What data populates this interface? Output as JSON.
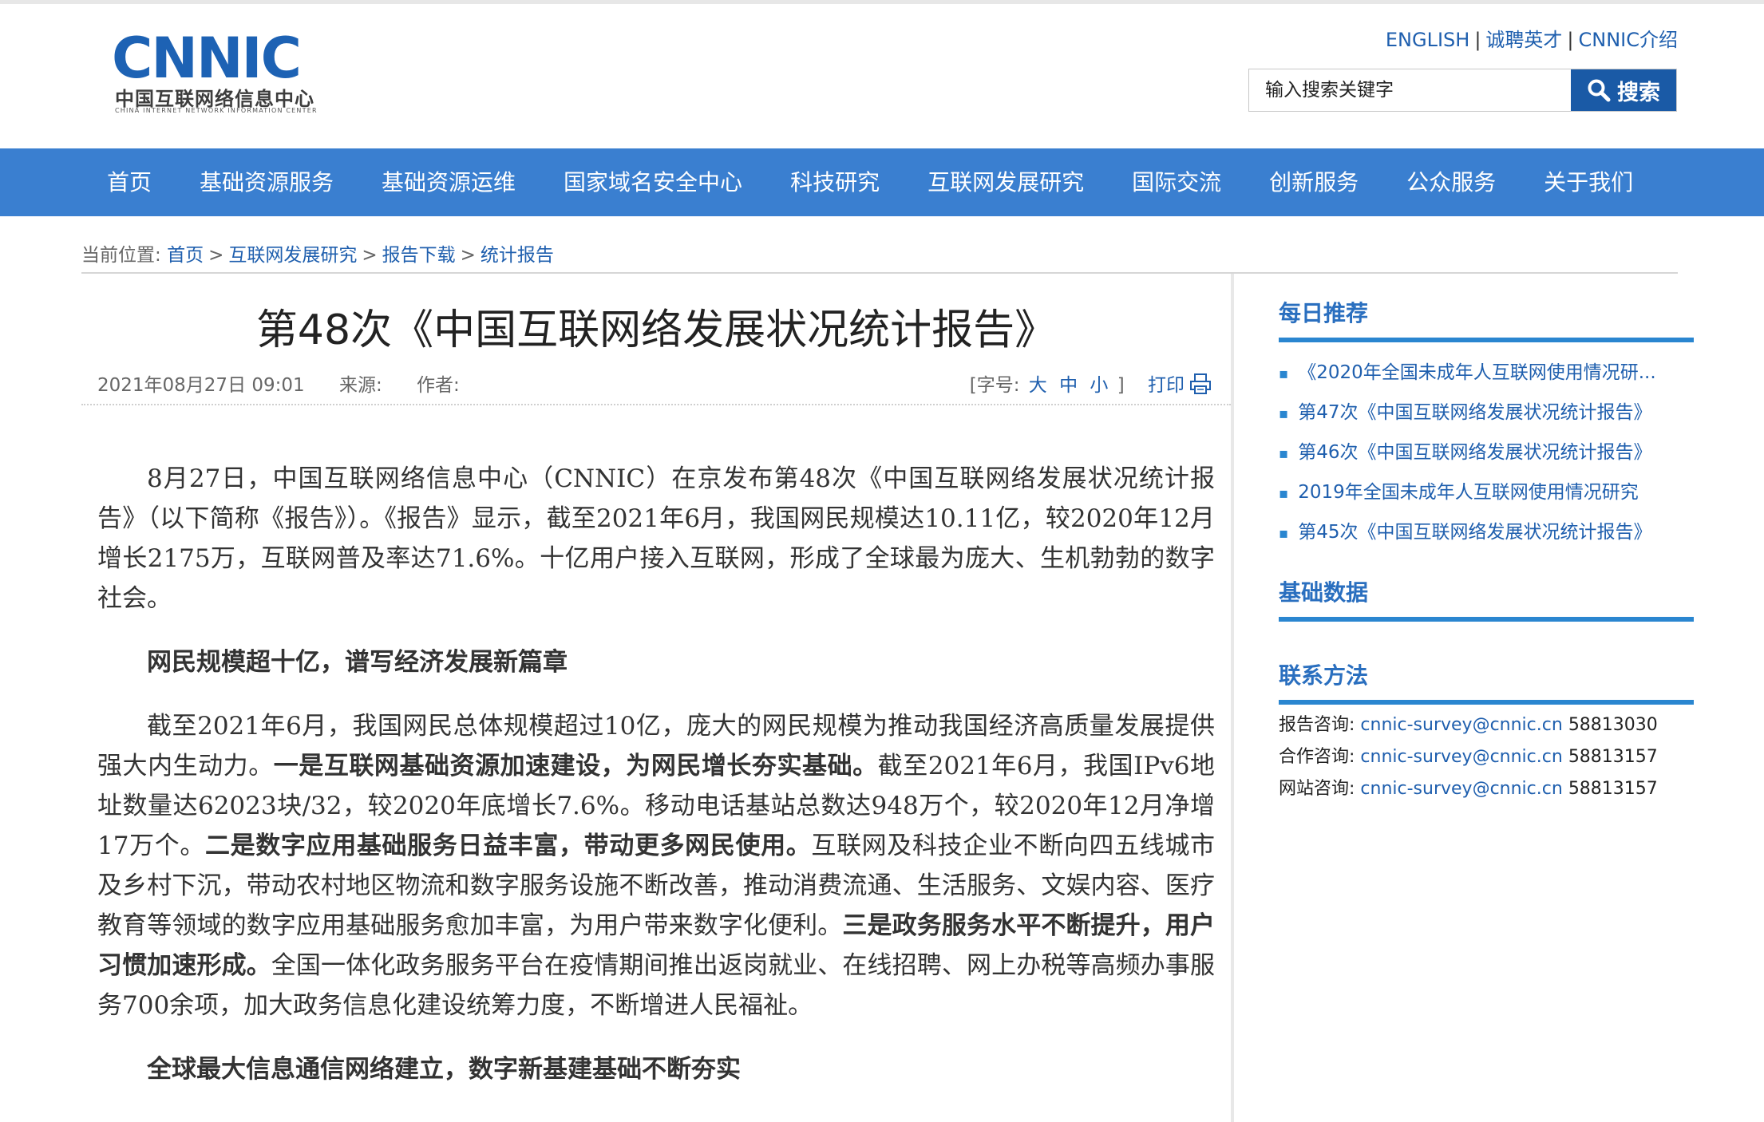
{
  "header": {
    "logo_text": "CNNIC",
    "logo_cn": "中国互联网络信息中心",
    "logo_en": "CHINA INTERNET NETWORK INFORMATION CENTER",
    "links": [
      "ENGLISH",
      "诚聘英才",
      "CNNIC介绍"
    ],
    "search_placeholder": "输入搜索关键字",
    "search_button": "搜索"
  },
  "nav": [
    "首页",
    "基础资源服务",
    "基础资源运维",
    "国家域名安全中心",
    "科技研究",
    "互联网发展研究",
    "国际交流",
    "创新服务",
    "公众服务",
    "关于我们"
  ],
  "breadcrumb": {
    "label": "当前位置:",
    "items": [
      "首页",
      "互联网发展研究",
      "报告下载",
      "统计报告"
    ]
  },
  "article": {
    "title": "第48次《中国互联网络发展状况统计报告》",
    "date": "2021年08月27日 09:01",
    "source_label": "来源:",
    "author_label": "作者:",
    "font_label_open": "[字号:",
    "font_big": "大",
    "font_mid": "中",
    "font_small": "小",
    "font_label_close": "]",
    "print": "打印",
    "p1": "8月27日，中国互联网络信息中心（CNNIC）在京发布第48次《中国互联网络发展状况统计报告》（以下简称《报告》）。《报告》显示，截至2021年6月，我国网民规模达10.11亿，较2020年12月增长2175万，互联网普及率达71.6%。十亿用户接入互联网，形成了全球最为庞大、生机勃勃的数字社会。",
    "h1": "网民规模超十亿，谱写经济发展新篇章",
    "p2a": "截至2021年6月，我国网民总体规模超过10亿，庞大的网民规模为推动我国经济高质量发展提供强大内生动力。",
    "p2b": "一是互联网基础资源加速建设，为网民增长夯实基础。",
    "p2c": "截至2021年6月，我国IPv6地址数量达62023块/32，较2020年底增长7.6%。移动电话基站总数达948万个，较2020年12月净增17万个。",
    "p2d": "二是数字应用基础服务日益丰富，带动更多网民使用。",
    "p2e": "互联网及科技企业不断向四五线城市及乡村下沉，带动农村地区物流和数字服务设施不断改善，推动消费流通、生活服务、文娱内容、医疗教育等领域的数字应用基础服务愈加丰富，为用户带来数字化便利。",
    "p2f": "三是政务服务水平不断提升，用户习惯加速形成。",
    "p2g": "全国一体化政务服务平台在疫情期间推出返岗就业、在线招聘、网上办税等高频办事服务700余项，加大政务信息化建设统筹力度，不断增进人民福祉。",
    "h2": "全球最大信息通信网络建立，数字新基建基础不断夯实"
  },
  "sidebar": {
    "daily_title": "每日推荐",
    "daily_items": [
      "《2020年全国未成年人互联网使用情况研...",
      "第47次《中国互联网络发展状况统计报告》",
      "第46次《中国互联网络发展状况统计报告》",
      "2019年全国未成年人互联网使用情况研究",
      "第45次《中国互联网络发展状况统计报告》"
    ],
    "basic_title": "基础数据",
    "contact_title": "联系方法",
    "contacts": [
      {
        "label": "报告咨询:",
        "email": "cnnic-survey@cnnic.cn",
        "phone": "58813030"
      },
      {
        "label": "合作咨询:",
        "email": "cnnic-survey@cnnic.cn",
        "phone": "58813157"
      },
      {
        "label": "网站咨询:",
        "email": "cnnic-survey@cnnic.cn",
        "phone": "58813157"
      }
    ]
  },
  "colors": {
    "nav_bg": "#3a7fd0",
    "brand_blue": "#1d62b4",
    "link": "#1f5fae",
    "search_button": "#1a5aa6"
  }
}
